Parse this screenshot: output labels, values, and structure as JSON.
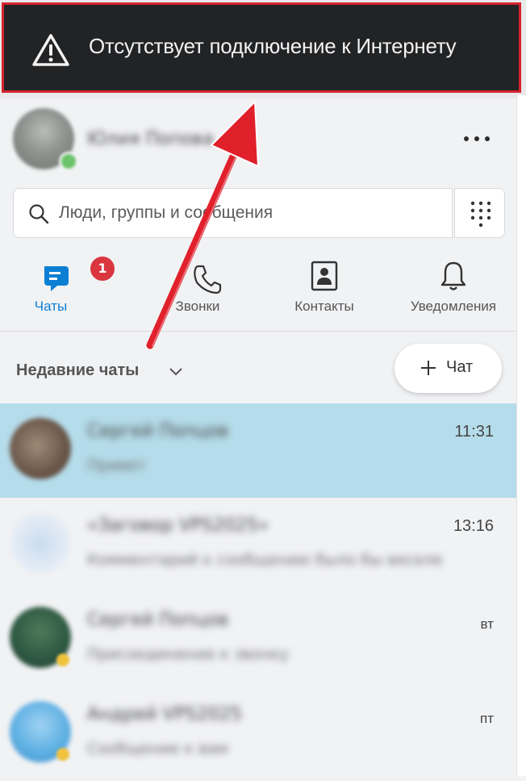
{
  "banner": {
    "message": "Отсутствует подключение к Интернету",
    "icon": "warning-icon",
    "border_color": "#d6232d",
    "background": "#222325"
  },
  "profile": {
    "name": "Юлия Попова",
    "more_icon": "more-horizontal-icon"
  },
  "search": {
    "placeholder": "Люди, группы и сообщения",
    "icon": "search-icon",
    "dialpad_icon": "dialpad-icon"
  },
  "tabs": [
    {
      "label": "Чаты",
      "icon": "chat-icon",
      "active": true,
      "badge": "1"
    },
    {
      "label": "Звонки",
      "icon": "phone-icon",
      "active": false
    },
    {
      "label": "Контакты",
      "icon": "contacts-icon",
      "active": false
    },
    {
      "label": "Уведомления",
      "icon": "bell-icon",
      "active": false
    }
  ],
  "recent": {
    "title": "Недавние чаты",
    "new_chat_label": "Чат"
  },
  "chats": [
    {
      "name": "Сергей Попцов",
      "preview": "Привет",
      "time": "11:31",
      "selected": true
    },
    {
      "name": "«Заговор VPS2025»",
      "preview": "Комментарий к сообщению было бы веселее",
      "time": "13:16",
      "selected": false
    },
    {
      "name": "Сергей Попцов",
      "preview": "Присоединение к звонку",
      "time": "вт",
      "selected": false
    },
    {
      "name": "Андрей VPS2025",
      "preview": "Сообщение к вам",
      "time": "пт",
      "selected": false
    }
  ],
  "colors": {
    "accent": "#0b7fd4",
    "badge": "#d9363e",
    "selected_row": "#b5dcea",
    "annotation_arrow": "#e0202b"
  }
}
